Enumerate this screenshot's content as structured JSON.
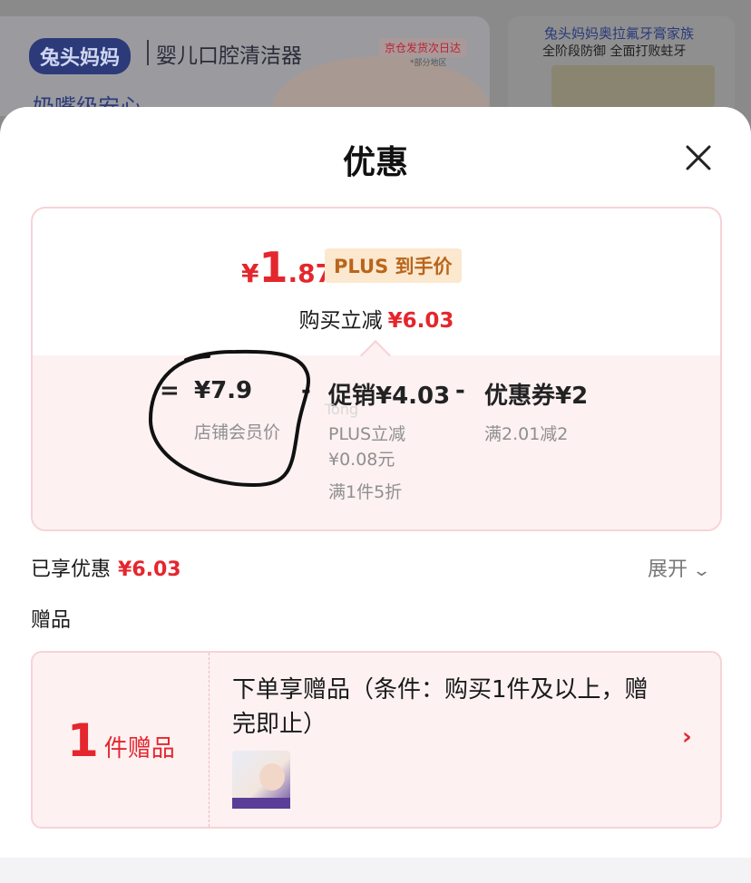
{
  "background": {
    "brand": "兔头妈妈",
    "product": "婴儿口腔清洁器",
    "tag": "京仓发货次日达",
    "tag_sub": "*部分地区",
    "slogan": "奶嘴级安心",
    "ad_line1": "兔头妈妈奥拉氟牙膏家族",
    "ad_line2": "全阶段防御 全面打败蛀牙"
  },
  "sheet": {
    "title": "优惠",
    "close_icon": "close-icon"
  },
  "price_card": {
    "final_currency": "¥",
    "final_int": "1",
    "final_dec": ".87",
    "plus_badge": "PLUS 到手价",
    "reduce_label": "购买立减",
    "reduce_amount": "¥6.03",
    "eq": "=",
    "member_price": "¥7.9",
    "member_label": "店铺会员价",
    "minus1": "-",
    "promo_amount": "促销¥4.03",
    "promo_detail1": "PLUS立减",
    "promo_detail2": "¥0.08元",
    "promo_detail3": "满1件5折",
    "minus2": "-",
    "coupon_amount": "优惠券¥2",
    "coupon_detail": "满2.01减2",
    "watermark": "Tong"
  },
  "enjoyed": {
    "label": "已享优惠",
    "amount": "¥6.03",
    "expand_label": "展开",
    "expand_icon": "chevron-down-icon"
  },
  "gifts": {
    "section_label": "赠品",
    "count": "1",
    "count_label": "件赠品",
    "description": "下单享赠品（条件：购买1件及以上，赠完即止）",
    "arrow": "›"
  },
  "colors": {
    "accent": "#e4262d",
    "card_border": "#f7d3d6",
    "card_bg": "#fdf1f2",
    "plus_badge_bg": "#fbe8cf",
    "plus_badge_text": "#b9651b"
  }
}
